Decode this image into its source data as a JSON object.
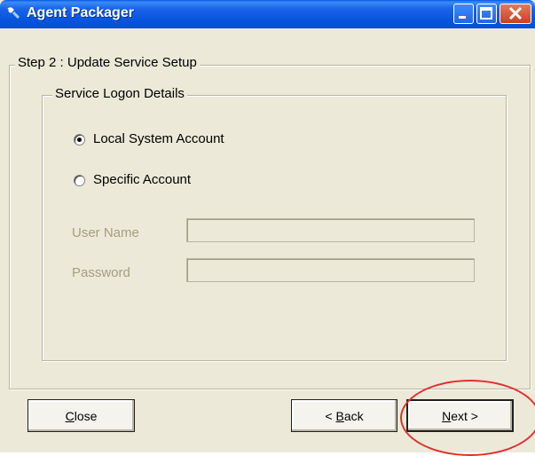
{
  "window": {
    "title": "Agent Packager"
  },
  "step_group": {
    "label": "Step 2 : Update Service Setup"
  },
  "logon_group": {
    "label": "Service Logon Details"
  },
  "options": [
    {
      "label": "Local System Account",
      "selected": true
    },
    {
      "label": "Specific Account",
      "selected": false
    }
  ],
  "fields": {
    "user_name": {
      "label": "User Name",
      "value": ""
    },
    "password": {
      "label": "Password",
      "value": ""
    }
  },
  "buttons": {
    "close": {
      "accel": "C",
      "rest": "lose"
    },
    "back": {
      "prefix": "< ",
      "accel": "B",
      "rest": "ack"
    },
    "next": {
      "accel": "N",
      "rest": "ext >"
    }
  },
  "colors": {
    "annotation": "#e03030",
    "disabled_text": "#a49f80"
  }
}
